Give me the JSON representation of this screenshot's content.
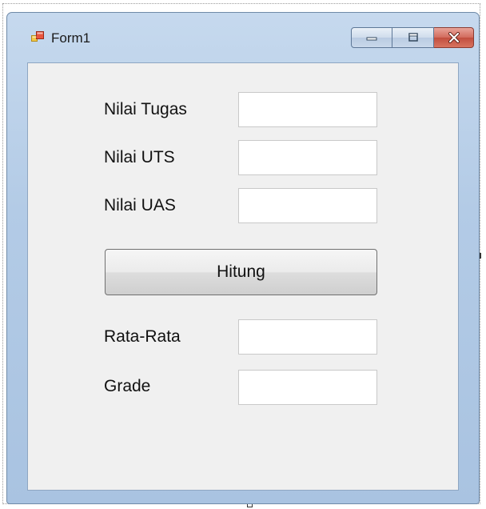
{
  "window": {
    "title": "Form1",
    "icon": "winforms-form-icon",
    "controls": {
      "minimize_icon": "minimize-icon",
      "maximize_icon": "maximize-icon",
      "close_icon": "close-icon"
    }
  },
  "form": {
    "fields": [
      {
        "label": "Nilai Tugas",
        "value": ""
      },
      {
        "label": "Nilai UTS",
        "value": ""
      },
      {
        "label": "Nilai UAS",
        "value": ""
      }
    ],
    "button_label": "Hitung",
    "results": [
      {
        "label": "Rata-Rata",
        "value": ""
      },
      {
        "label": "Grade",
        "value": ""
      }
    ]
  },
  "colors": {
    "window_frame": "#b3cbe6",
    "client_background": "#f0f0f0",
    "close_button": "#c14e3f"
  }
}
